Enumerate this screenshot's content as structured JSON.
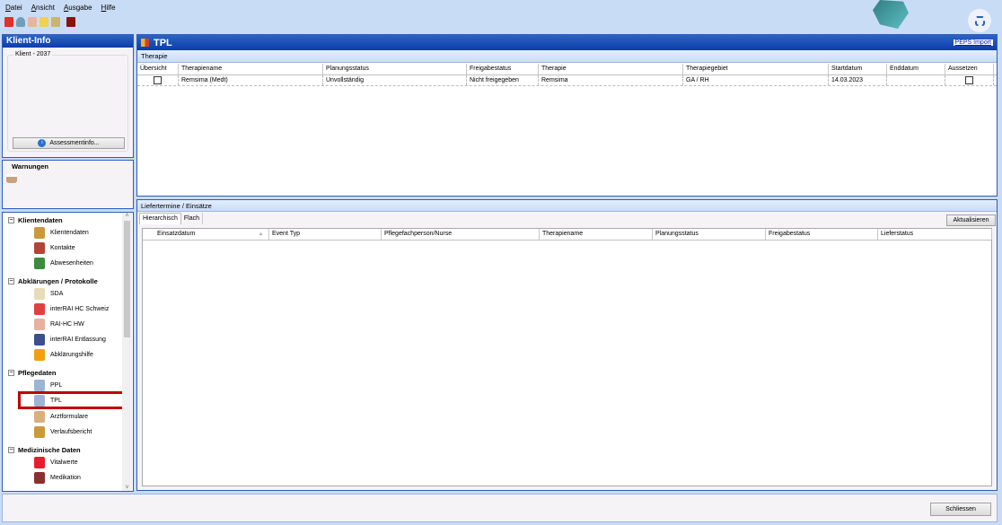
{
  "menu": [
    "Datei",
    "Ansicht",
    "Ausgabe",
    "Hilfe"
  ],
  "toolbar_icons": [
    "red-document-icon",
    "user-icon",
    "checklist-icon",
    "note-icon",
    "person-card-icon",
    "book-icon"
  ],
  "left": {
    "title": "Klient-Info",
    "client_label": "Klient - 2037",
    "assessment_button": "Assessmentinfo...",
    "warnings_title": "Warnungen",
    "tree": [
      {
        "header": "Klientendaten",
        "items": [
          {
            "label": "Klientendaten",
            "icon": "folder-icon",
            "color": "#c89a3c"
          },
          {
            "label": "Kontakte",
            "icon": "people-icon",
            "color": "#b0453a"
          },
          {
            "label": "Abwesenheiten",
            "icon": "door-exit-icon",
            "color": "#3d8b3d"
          }
        ]
      },
      {
        "header": "Abklärungen / Protokolle",
        "items": [
          {
            "label": "SDA",
            "icon": "pencil-document-icon",
            "color": "#e8dcb8"
          },
          {
            "label": "interRAI HC Schweiz",
            "icon": "interrai-icon",
            "color": "#e04040"
          },
          {
            "label": "RAI-HC HW",
            "icon": "house-document-icon",
            "color": "#e8b0a0"
          },
          {
            "label": "interRAI Entlassung",
            "icon": "discharge-icon",
            "color": "#3a4f8c"
          },
          {
            "label": "Abklärungshilfe",
            "icon": "warning-icon",
            "color": "#f0a010"
          }
        ]
      },
      {
        "header": "Pflegedaten",
        "items": [
          {
            "label": "PPL",
            "icon": "clock-folder-icon",
            "color": "#9db4d4"
          },
          {
            "label": "TPL",
            "icon": "clock-folder-icon",
            "color": "#9db4d4"
          },
          {
            "label": "Arztformulare",
            "icon": "doctor-icon",
            "color": "#d8b080"
          },
          {
            "label": "Verlaufsbericht",
            "icon": "folder-clock-icon",
            "color": "#c89a3c"
          }
        ]
      },
      {
        "header": "Medizinische Daten",
        "items": [
          {
            "label": "Vitalwerte",
            "icon": "heart-icon",
            "color": "#e02030"
          },
          {
            "label": "Medikation",
            "icon": "pills-icon",
            "color": "#8a3030"
          }
        ]
      }
    ],
    "selected": "TPL",
    "highlight_color": "#c00000"
  },
  "main": {
    "title": "TPL",
    "peps_link": "PEPS Import",
    "therapie_bar": "Therapie",
    "columns": [
      "Übersicht",
      "Therapiename",
      "Planungsstatus",
      "Freigabestatus",
      "Therapie",
      "Therapiegebiet",
      "Startdatum",
      "Enddatum",
      "Aussetzen"
    ],
    "rows": [
      {
        "uebersicht": false,
        "cells": [
          "",
          "Remsima (Medt)",
          "Unvollständig",
          "Nicht freigegeben",
          "Remsima",
          "GA / RH",
          "14.03.2023",
          "",
          ""
        ],
        "aussetzen": false
      }
    ],
    "lower_bar": "Liefertermine / Einsätze",
    "tabs": [
      "Hierarchisch",
      "Flach"
    ],
    "active_tab": "Hierarchisch",
    "refresh_button": "Aktualisieren",
    "lower_columns": [
      "Einsatzdatum",
      "Event Typ",
      "Pflegefachperson/Nurse",
      "Therapiename",
      "Planungsstatus",
      "Freigabestatus",
      "Lieferstatus"
    ]
  },
  "footer": {
    "close_button": "Schliessen"
  }
}
